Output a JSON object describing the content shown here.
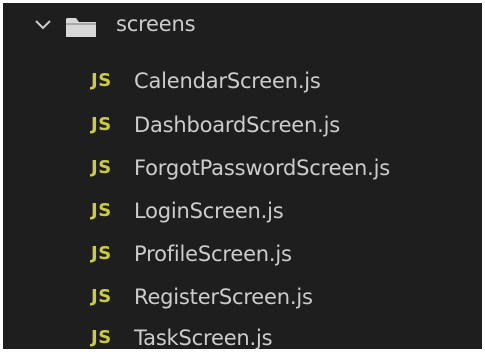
{
  "explorer": {
    "folder": {
      "label": "screens",
      "expanded_icon": "chevron-down-icon",
      "icon": "folder-icon",
      "icon_color": "#d7d7d7"
    },
    "file_badge": "JS",
    "file_badge_color": "#cbcb41",
    "files": [
      {
        "name": "CalendarScreen.js"
      },
      {
        "name": "DashboardScreen.js"
      },
      {
        "name": "ForgotPasswordScreen.js"
      },
      {
        "name": "LoginScreen.js"
      },
      {
        "name": "ProfileScreen.js"
      },
      {
        "name": "RegisterScreen.js"
      },
      {
        "name": "TaskScreen.js"
      }
    ],
    "background_color": "#1e1e1e",
    "text_color": "#cccccc"
  }
}
